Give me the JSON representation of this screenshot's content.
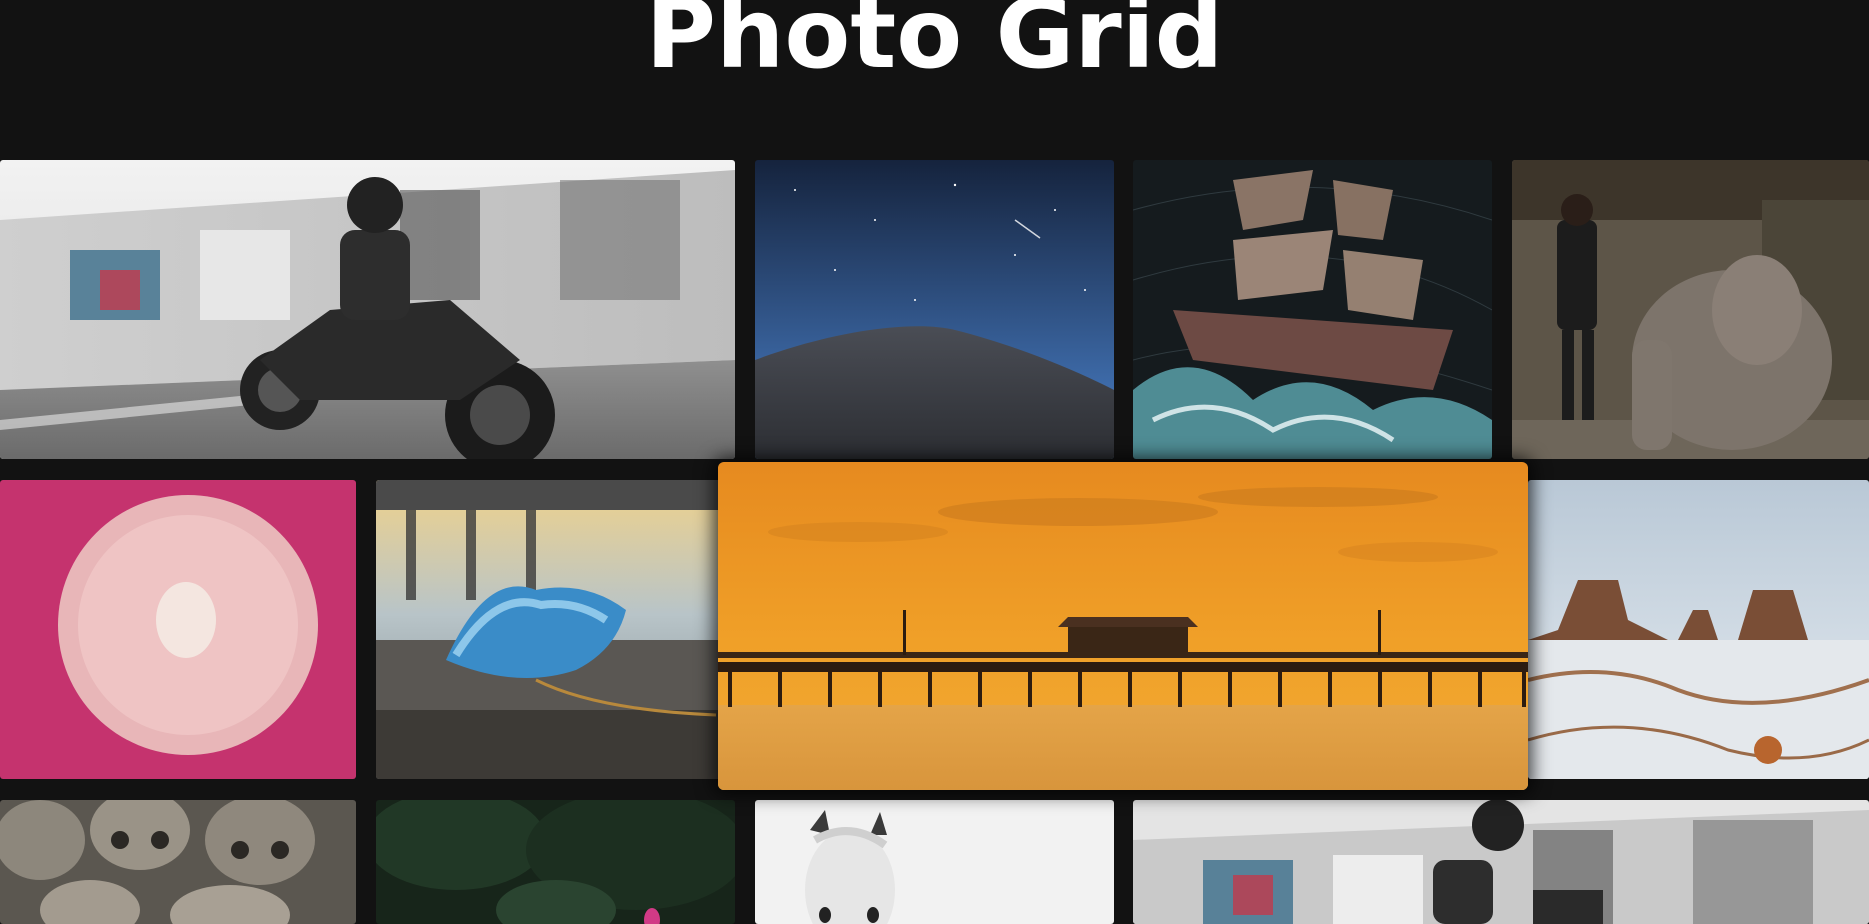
{
  "header": {
    "title": "Photo Grid"
  },
  "gallery": {
    "photos": [
      {
        "subject": "motorcycle-rider"
      },
      {
        "subject": "night-sky-sand-dune"
      },
      {
        "subject": "sailing-ship-drawing"
      },
      {
        "subject": "man-with-elephant"
      },
      {
        "subject": "egg-on-pink-plate"
      },
      {
        "subject": "jellyfish-on-beach"
      },
      {
        "subject": "pier-at-orange-sunset"
      },
      {
        "subject": "snowy-desert-buttes"
      },
      {
        "subject": "skulls"
      },
      {
        "subject": "dark-leaves-flower"
      },
      {
        "subject": "white-horse"
      },
      {
        "subject": "motorcycle-rider"
      }
    ]
  },
  "colors": {
    "background": "#121212",
    "title": "#ffffff",
    "pink": "#c5336e",
    "sunset": "#f0a028"
  }
}
